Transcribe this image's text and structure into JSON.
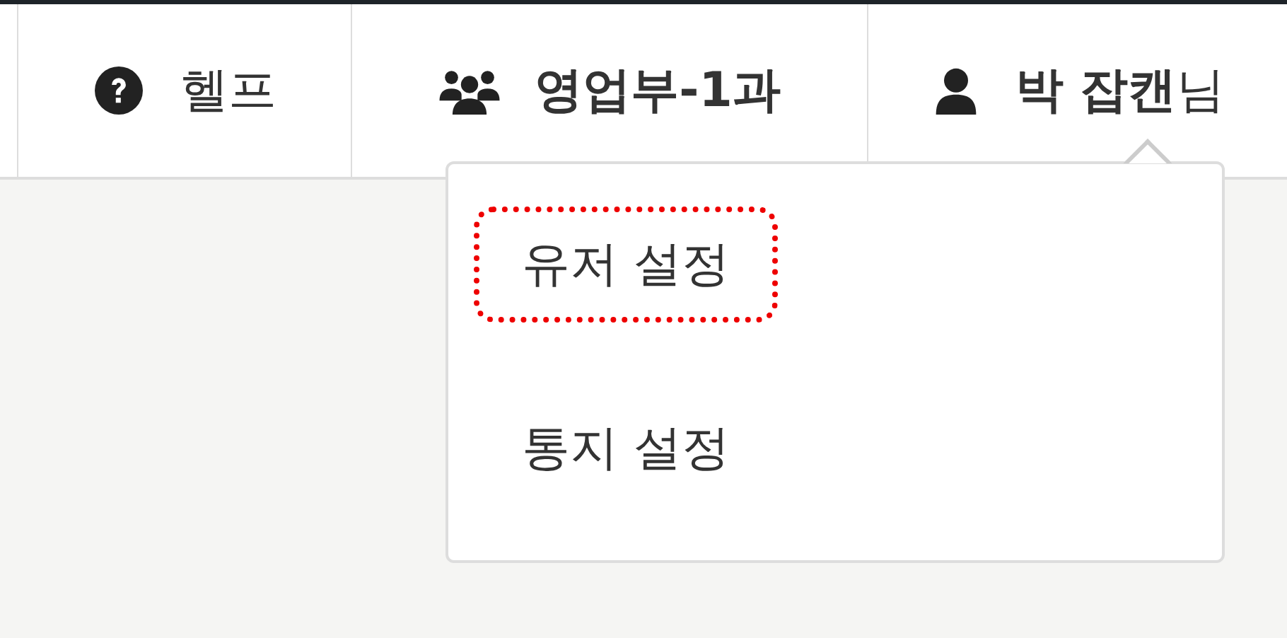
{
  "nav": [
    {
      "kind": "help",
      "label": "헬프"
    },
    {
      "kind": "group",
      "label": "영업부-1과"
    },
    {
      "kind": "user",
      "label": "**박 잡캔**님"
    }
  ],
  "dropdown": {
    "items": [
      {
        "label": "유저 설정",
        "highlighted": true
      },
      {
        "label": "통지 설정",
        "highlighted": false
      }
    ]
  }
}
